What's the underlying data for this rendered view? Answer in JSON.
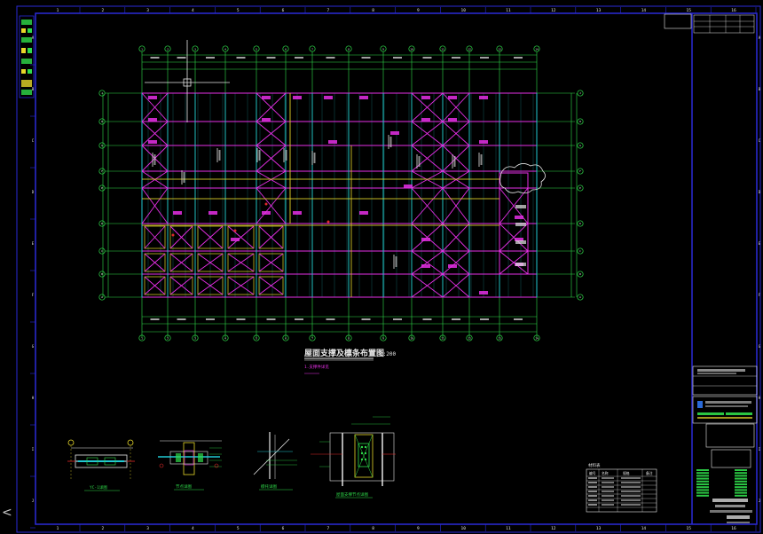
{
  "colors": {
    "background": "#000000",
    "frame": "#2a2ad8",
    "axis_grid": "#2fdc4a",
    "beam": "#e62fe6",
    "column_line": "#21c9d2",
    "yellow": "#e6d72a",
    "white": "#e6e6e6",
    "red": "#e02a2a",
    "orange": "#d98a1a"
  },
  "border_numbers": {
    "top": [
      "1",
      "2",
      "3",
      "4",
      "5",
      "6",
      "7",
      "8",
      "9",
      "10",
      "11",
      "12",
      "13",
      "14",
      "15",
      "16"
    ],
    "bottom": [
      "1",
      "2",
      "3",
      "4",
      "5",
      "6",
      "7",
      "8",
      "9",
      "10",
      "11",
      "12",
      "13",
      "14",
      "15",
      "16"
    ],
    "left": [
      "A",
      "B",
      "C",
      "D",
      "E",
      "F",
      "G",
      "H",
      "I",
      "J"
    ],
    "right": [
      "A",
      "B",
      "C",
      "D",
      "E",
      "F",
      "G",
      "H",
      "I",
      "J"
    ]
  },
  "plan": {
    "title": "屋面支撑及檩条布置图",
    "scale": "1:200",
    "note": "1.支撑件详见",
    "column_axes": [
      "1",
      "2",
      "3",
      "4",
      "5",
      "6",
      "7",
      "8",
      "9",
      "10",
      "11",
      "12",
      "13",
      "14",
      "15",
      "16"
    ],
    "row_axes": [
      "A",
      "B",
      "C",
      "D",
      "E",
      "F",
      "G",
      "H",
      "J"
    ]
  },
  "details": {
    "d1": "YC-1详图",
    "d2": "节点详图",
    "d3": "檩托详图",
    "d4": "屋面支撑节点详图"
  },
  "material_table": {
    "title": "材料表",
    "headers": [
      "编号",
      "名称",
      "规格",
      "备注"
    ]
  }
}
